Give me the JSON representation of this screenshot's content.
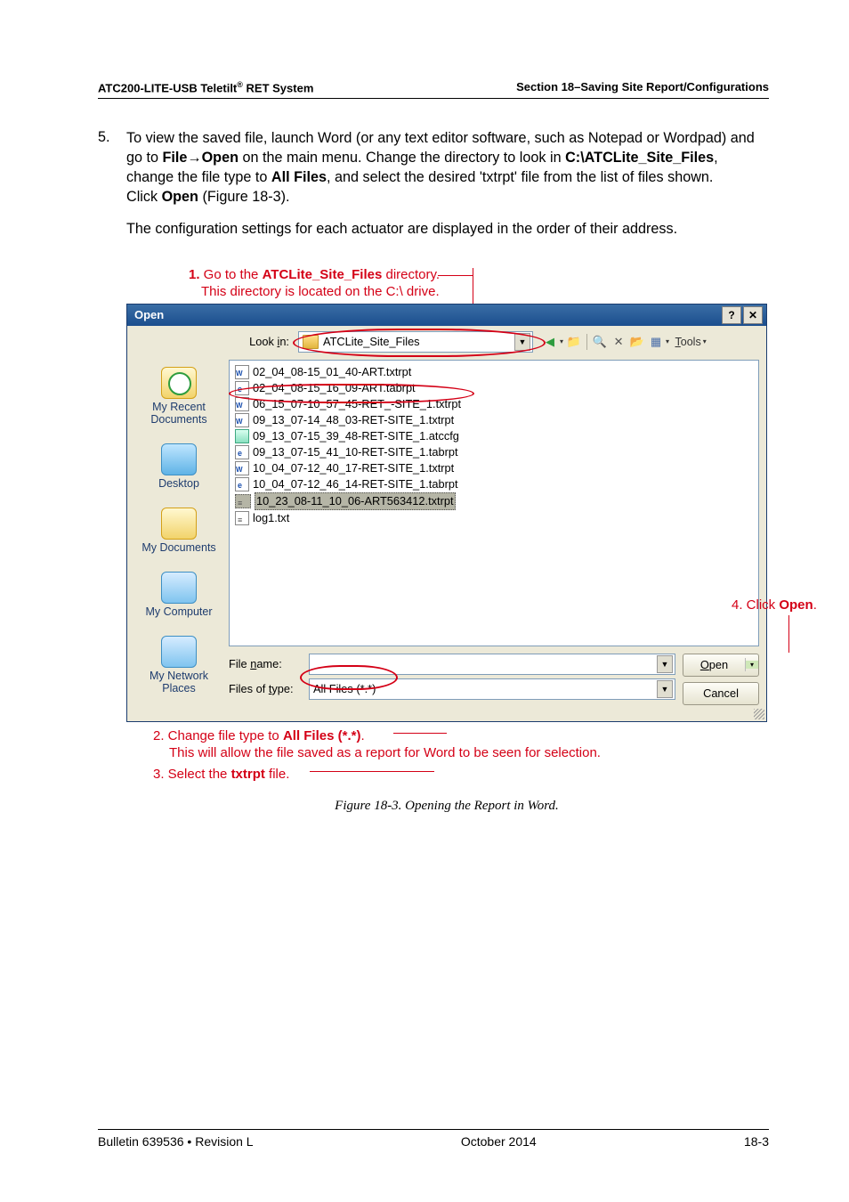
{
  "header": {
    "left_prefix": "ATC200-LITE-USB Teletilt",
    "left_sup": "®",
    "left_suffix": " RET System",
    "right": "Section 18–Saving Site Report/Configurations"
  },
  "step": {
    "num": "5.",
    "t1": "To view the saved file, launch Word (or any text editor software, such as Notepad or Wordpad) and go to ",
    "b1": "File",
    "arrow1": "→",
    "b2": "Open",
    "t2": " on the main menu. Change the directory to look in ",
    "b3": "C:\\ATCLite_Site_Files",
    "t3a": ", change the file type to ",
    "b4": "All Files",
    "t3b": ", and select the desired 'txtrpt' file from the list of files shown.",
    "t4a": "Click ",
    "b5": "Open",
    "t4b": " (Figure 18-3).",
    "follow": "The configuration settings for each actuator are displayed in the order of their address."
  },
  "callouts": {
    "top1_a": "1.",
    "top1_b": " Go to the ",
    "top1_c": "ATCLite_Site_Files",
    "top1_d": " directory.",
    "top2": "This directory is located on the C:\\ drive.",
    "right1": "4. Click ",
    "right1b": "Open",
    "right1c": ".",
    "bot1_a": "2.  Change file type to ",
    "bot1_b": "All Files (*.*)",
    "bot1_c": ".",
    "bot2": "This will allow the file saved as a report for Word to be seen  for selection.",
    "bot3_a": "3.  Select the ",
    "bot3_b": "txtrpt",
    "bot3_c": " file."
  },
  "dialog": {
    "title": "Open",
    "help": "?",
    "close": "✕",
    "look_in_label_pre": "Look ",
    "look_in_label_ul": "i",
    "look_in_label_post": "n:",
    "look_in_value": "ATCLite_Site_Files",
    "toolbar_tools": "Tools",
    "places": {
      "recent": "My Recent Documents",
      "desktop": "Desktop",
      "mydocs": "My Documents",
      "mycomp": "My Computer",
      "network": "My Network Places"
    },
    "files": [
      {
        "name": "02_04_08-15_01_40-ART.txtrpt",
        "k": "word"
      },
      {
        "name": "02_04_08-15_16_09-ART.tabrpt",
        "k": "html"
      },
      {
        "name": "06_15_07-10_57_45-RET_-SITE_1.txtrpt",
        "k": "word"
      },
      {
        "name": "09_13_07-14_48_03-RET-SITE_1.txtrpt",
        "k": "word"
      },
      {
        "name": "09_13_07-15_39_48-RET-SITE_1.atccfg",
        "k": "cfg"
      },
      {
        "name": "09_13_07-15_41_10-RET-SITE_1.tabrpt",
        "k": "html"
      },
      {
        "name": "10_04_07-12_40_17-RET-SITE_1.txtrpt",
        "k": "word"
      },
      {
        "name": "10_04_07-12_46_14-RET-SITE_1.tabrpt",
        "k": "html"
      },
      {
        "name": "10_23_08-11_10_06-ART563412.txtrpt",
        "k": "txt",
        "sel": true
      },
      {
        "name": "log1.txt",
        "k": "txt"
      }
    ],
    "filename_label_pre": "File ",
    "filename_label_ul": "n",
    "filename_label_post": "ame:",
    "filetype_label_pre": "Files of ",
    "filetype_label_ul": "t",
    "filetype_label_post": "ype:",
    "filetype_value": "All Files (*.*)",
    "open_btn_ul": "O",
    "open_btn_post": "pen",
    "cancel_btn": "Cancel"
  },
  "caption": "Figure 18-3. Opening the Report in Word.",
  "footer": {
    "left": "Bulletin 639536  •  Revision L",
    "center": "October 2014",
    "right": "18-3"
  }
}
